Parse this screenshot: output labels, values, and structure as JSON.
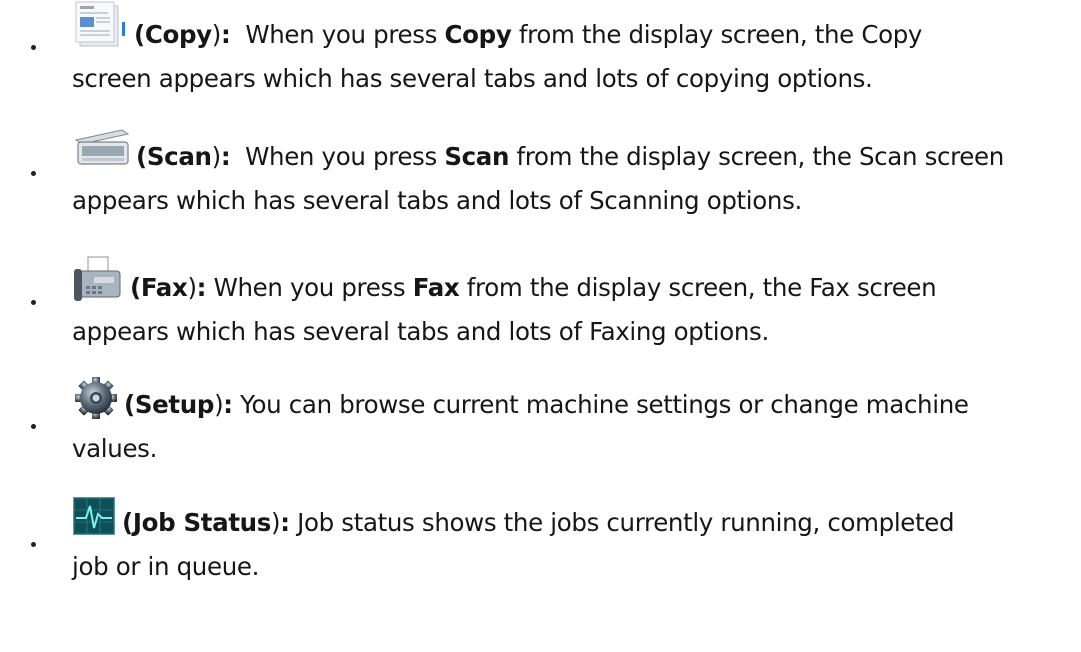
{
  "items": [
    {
      "icon": "copy-document-icon",
      "paren_open": "(",
      "term": "Copy",
      "paren_close": ")",
      "colon": ":",
      "body_a": "  When you press ",
      "bold_word": "Copy",
      "body_b": " from the display screen, the Copy",
      "line2": "screen appears which has several tabs and lots of copying options."
    },
    {
      "icon": "scanner-icon",
      "paren_open": "(",
      "term": "Scan",
      "paren_close": ")",
      "colon": ":",
      "body_a": "  When you press ",
      "bold_word": "Scan",
      "body_b": " from the display screen, the Scan screen",
      "line2": "appears which has several tabs and lots of Scanning options."
    },
    {
      "icon": "fax-machine-icon",
      "paren_open": "(",
      "term": "Fax",
      "paren_close": ")",
      "colon": ":",
      "body_a": " When you press ",
      "bold_word": "Fax",
      "body_b": " from the display screen, the Fax screen",
      "line2": "appears which has several tabs and lots of Faxing options."
    },
    {
      "icon": "setup-gear-icon",
      "paren_open": "(",
      "term": "Setup",
      "paren_close": ")",
      "colon": ":",
      "body_a": " You can browse current machine settings or change machine",
      "line2": "values."
    },
    {
      "icon": "job-status-monitor-icon",
      "paren_open": "(",
      "term": "Job Status",
      "paren_close": ")",
      "colon": ":",
      "body_a": " Job status shows the jobs currently running, completed",
      "line2": "job or in queue."
    }
  ]
}
